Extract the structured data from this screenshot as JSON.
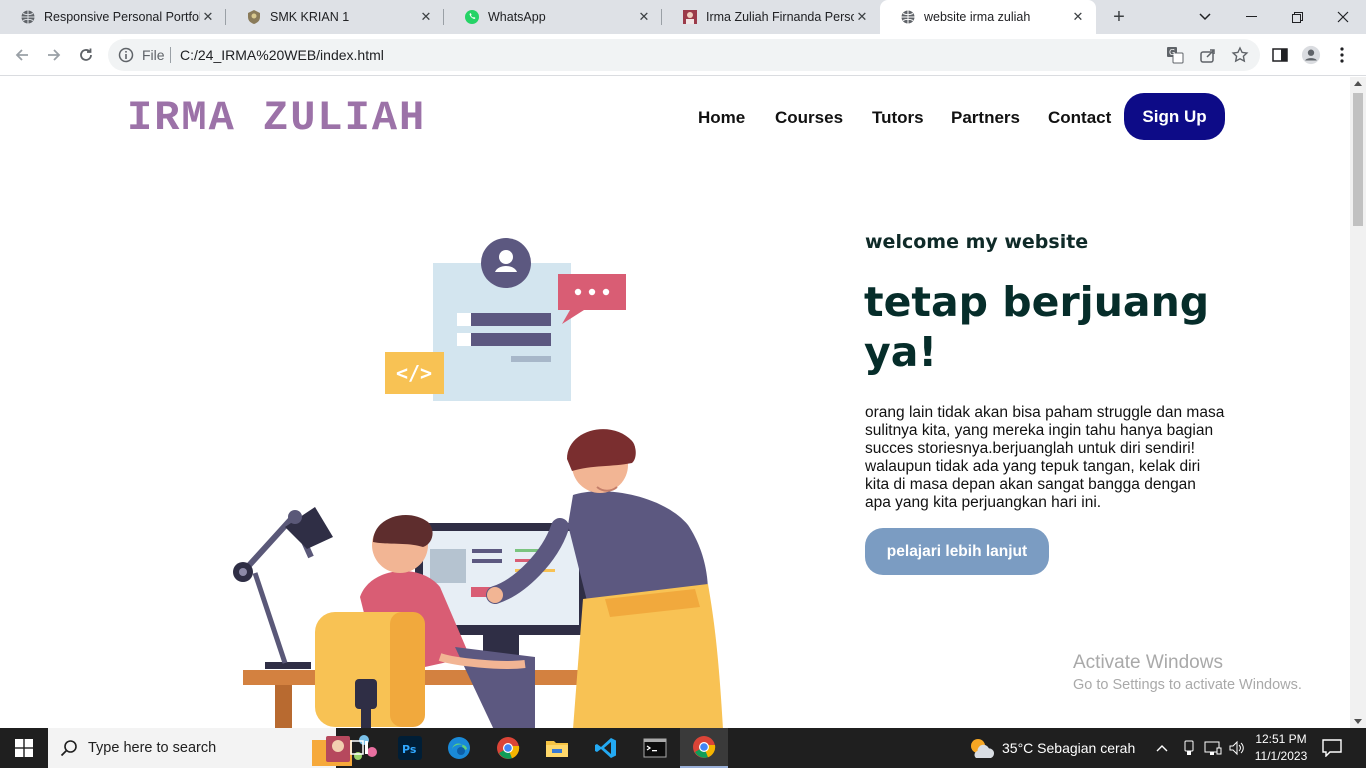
{
  "browser": {
    "tabs": [
      {
        "title": "Responsive Personal Portfolio",
        "icon": "globe-icon"
      },
      {
        "title": "SMK KRIAN 1",
        "icon": "school-crest-icon"
      },
      {
        "title": "WhatsApp",
        "icon": "whatsapp-icon"
      },
      {
        "title": "Irma Zuliah Firnanda Personal",
        "icon": "profile-photo-icon"
      },
      {
        "title": "website irma zuliah",
        "icon": "globe-icon",
        "active": true
      }
    ],
    "omnibox": {
      "scheme_label": "File",
      "url": "C:/24_IRMA%20WEB/index.html"
    }
  },
  "page": {
    "logo": "IRMA ZULIAH",
    "nav": [
      "Home",
      "Courses",
      "Tutors",
      "Partners",
      "Contact"
    ],
    "signup_label": "Sign Up",
    "welcome": "welcome my website",
    "headline": "tetap berjuang ya!",
    "paragraph": "orang lain tidak akan bisa paham struggle dan masa sulitnya kita, yang mereka ingin tahu hanya bagian succes storiesnya.berjuanglah untuk diri sendiri! walaupun tidak ada yang tepuk tangan, kelak diri kita di masa depan akan sangat bangga dengan apa yang kita perjuangkan hari ini.",
    "cta_label": "pelajari lebih lanjut",
    "illustration_code_tag": "</>"
  },
  "overlay": {
    "activate_title": "Activate Windows",
    "activate_sub": "Go to Settings to activate Windows."
  },
  "taskbar": {
    "search_placeholder": "Type here to search",
    "weather": "35°C  Sebagian cerah",
    "time": "12:51 PM",
    "date": "11/1/2023"
  },
  "colors": {
    "logo": "#9c72a8",
    "signup_bg": "#0d0b87",
    "cta_bg": "#7b9cc2",
    "headline": "#062d2a"
  }
}
